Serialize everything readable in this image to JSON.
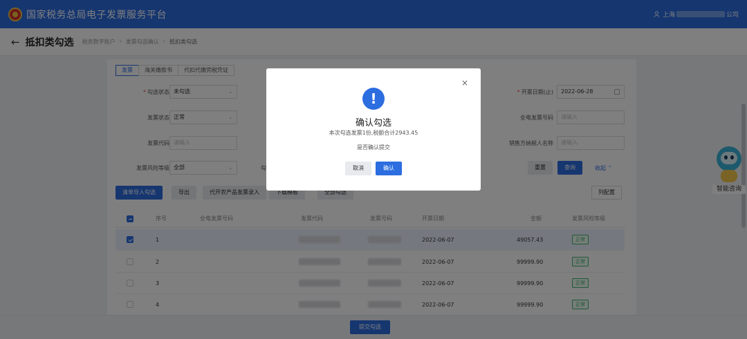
{
  "header": {
    "app_title": "国家税务总局电子发票服务平台",
    "user_prefix": "上海",
    "user_suffix": "公司"
  },
  "page": {
    "title": "抵扣类勾选",
    "breadcrumb": [
      "税务数字账户",
      "发票勾选确认",
      "抵扣类勾选"
    ]
  },
  "tabs": [
    "发票",
    "海关缴款书",
    "代扣代缴完税凭证"
  ],
  "filters": {
    "check_status_label": "勾选状态",
    "check_status_value": "未勾选",
    "invoice_status_label": "发票状态",
    "invoice_status_value": "正常",
    "invoice_code_label": "发票代码",
    "invoice_code_placeholder": "请输入",
    "risk_level_label": "发票风险等级",
    "risk_level_value": "全部",
    "issue_date_end_label": "开票日期(止)",
    "issue_date_end_value": "2022-06-28",
    "full_invoice_no_label": "全电发票号码",
    "full_invoice_no_placeholder": "请输入",
    "seller_tax_name_label": "销售方纳税人名称",
    "seller_tax_name_placeholder": "请输入",
    "partial_label": "勾"
  },
  "actions": {
    "reset": "重置",
    "query": "查询",
    "collapse": "收起",
    "import_check": "清单导入勾选",
    "export": "导出",
    "agri_entry": "代开农产品发票录入",
    "download_template": "下载模板",
    "check_all": "全部勾选",
    "column_config": "列配置",
    "submit": "提交勾选"
  },
  "table": {
    "columns": [
      "序号",
      "全电发票号码",
      "发票代码",
      "发票号码",
      "开票日期",
      "金额",
      "发票风险等级"
    ],
    "rows": [
      {
        "index": "1",
        "date": "2022-06-07",
        "amount": "49057.43",
        "risk": "正常",
        "selected": true
      },
      {
        "index": "2",
        "date": "2022-06-07",
        "amount": "99999.90",
        "risk": "正常",
        "selected": false
      },
      {
        "index": "3",
        "date": "2022-06-07",
        "amount": "99999.90",
        "risk": "正常",
        "selected": false
      },
      {
        "index": "4",
        "date": "2022-06-07",
        "amount": "99999.90",
        "risk": "正常",
        "selected": false
      }
    ]
  },
  "assistant": {
    "label": "智能咨询"
  },
  "modal": {
    "icon": "!",
    "title": "确认勾选",
    "summary": "本次勾选发票1份,税额合计2943.45",
    "question": "是否确认提交",
    "cancel": "取消",
    "confirm": "确认",
    "close": "×"
  },
  "colors": {
    "primary": "#2c6de0",
    "success": "#3bb56e"
  }
}
